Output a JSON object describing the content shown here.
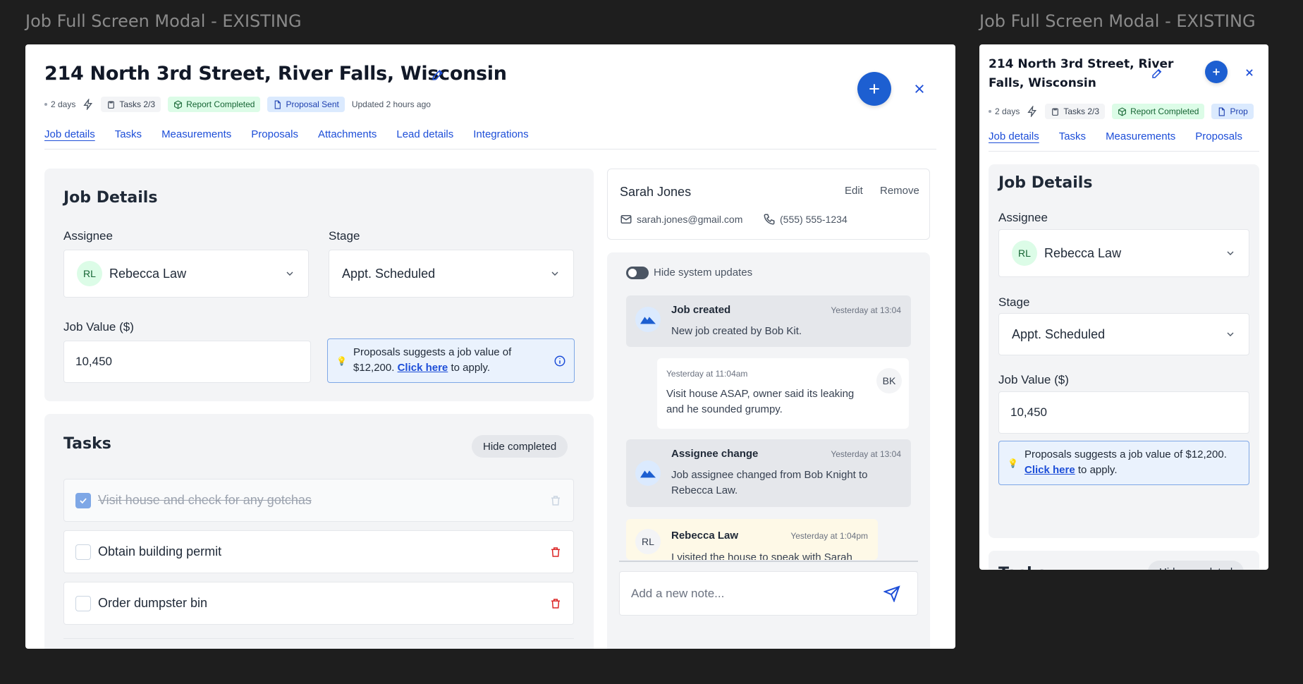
{
  "frames": {
    "main_label": "Job Full Screen Modal - EXISTING",
    "small_label": "Job Full Screen Modal - EXISTING"
  },
  "header": {
    "title": "214 North 3rd Street, River Falls, Wisconsin",
    "title_small_line1": "214 North 3rd Street, River",
    "title_small_line2": "Falls, Wisconsin",
    "age": "2 days",
    "tasks_chip": "Tasks 2/3",
    "report_chip": "Report Completed",
    "proposal_chip": "Proposal Sent",
    "proposal_chip_small": "Prop",
    "updated": "Updated 2 hours ago"
  },
  "tabs": [
    {
      "label": "Job details"
    },
    {
      "label": "Tasks"
    },
    {
      "label": "Measurements"
    },
    {
      "label": "Proposals"
    },
    {
      "label": "Attachments"
    },
    {
      "label": "Lead details"
    },
    {
      "label": "Integrations"
    }
  ],
  "job_details": {
    "title": "Job Details",
    "assignee_label": "Assignee",
    "assignee_initials": "RL",
    "assignee_value": "Rebecca Law",
    "stage_label": "Stage",
    "stage_value": "Appt. Scheduled",
    "job_value_label": "Job Value ($)",
    "job_value": "10,450",
    "suggest_text": "Proposals suggests a job value of",
    "suggest_amount": "$12,200.",
    "suggest_text_small": "Proposals suggests a job value of $12,200.",
    "suggest_link": "Click here",
    "suggest_suffix": "to apply."
  },
  "tasks": {
    "title": "Tasks",
    "hide_completed": "Hide completed",
    "items": [
      {
        "label": "Visit house and check for any gotchas"
      },
      {
        "label": "Obtain building permit"
      },
      {
        "label": "Order dumpster bin"
      }
    ]
  },
  "contact": {
    "name": "Sarah Jones",
    "edit": "Edit",
    "remove": "Remove",
    "email": "sarah.jones@gmail.com",
    "phone": "(555) 555-1234"
  },
  "activity": {
    "toggle_label": "Hide system updates",
    "items": [
      {
        "title": "Job created",
        "time": "Yesterday at 13:04",
        "body": "New job created by Bob Kit."
      },
      {
        "time": "Yesterday at 11:04am",
        "initials": "BK",
        "body_line1": "Visit house ASAP, owner said its leaking",
        "body_line2": "and he sounded grumpy."
      },
      {
        "title": "Assignee change",
        "time": "Yesterday at 13:04",
        "body_line1": "Job assignee changed from Bob Knight to",
        "body_line2": "Rebecca Law."
      },
      {
        "title": "Rebecca Law",
        "time": "Yesterday at 1:04pm",
        "initials": "RL",
        "body": "I visited the house to speak with Sarah"
      }
    ],
    "note_placeholder": "Add a new note..."
  },
  "colors": {
    "accent": "#1d5fd1",
    "link": "#1d4ed8",
    "success_bg": "#dcfce7",
    "info_bg": "#eaf2fd"
  }
}
